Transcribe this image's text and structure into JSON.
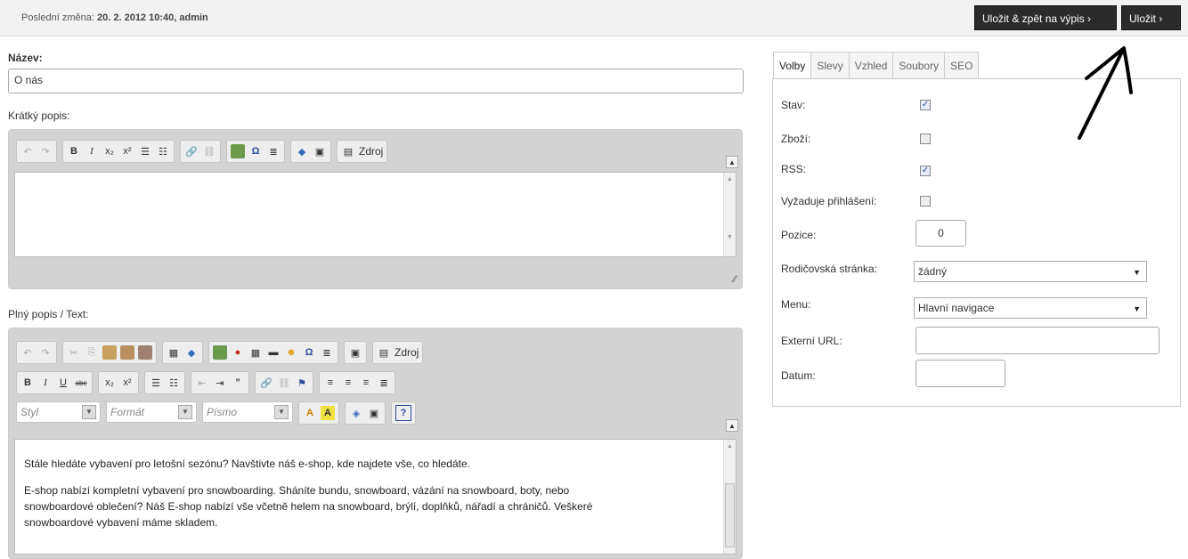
{
  "header": {
    "last_change_prefix": "Poslední změna:",
    "last_change_value": "20. 2. 2012 10:40, admin",
    "save_back_label": "Uložit & zpět na výpis ›",
    "save_label": "Uložit ›"
  },
  "form": {
    "name_label": "Název:",
    "name_value": "O nás",
    "short_label": "Krátký popis:",
    "full_label": "Plný popis / Text:"
  },
  "editor": {
    "source_label": "Zdroj",
    "style_label": "Styl",
    "format_label": "Formát",
    "font_label": "Písmo",
    "content": [
      "Stále hledáte vybavení pro letošní sezónu? Navštivte náš e-shop, kde najdete vše, co hledáte.",
      "E-shop nabízí kompletní vybavení pro snowboarding. Sháníte bundu, snowboard, vázání na snowboard, boty, nebo snowboardové oblečení? Náš E-shop nabízí vše včetně helem na snowboard, brýlí, doplňků, nářadí a chráničů. Veškeré snowboardové vybavení máme skladem."
    ]
  },
  "tabs": [
    "Volby",
    "Slevy",
    "Vzhled",
    "Soubory",
    "SEO"
  ],
  "options": {
    "stav_label": "Stav:",
    "stav_checked": true,
    "zbozi_label": "Zboží:",
    "zbozi_checked": false,
    "rss_label": "RSS:",
    "rss_checked": true,
    "login_label": "Vyžaduje přihlášení:",
    "login_checked": false,
    "pozice_label": "Pozice:",
    "pozice_value": "0",
    "parent_label": "Rodičovská stránka:",
    "parent_value": "žádný",
    "menu_label": "Menu:",
    "menu_value": "Hlavní navigace",
    "url_label": "Externí URL:",
    "url_value": "",
    "datum_label": "Datum:",
    "datum_value": ""
  }
}
